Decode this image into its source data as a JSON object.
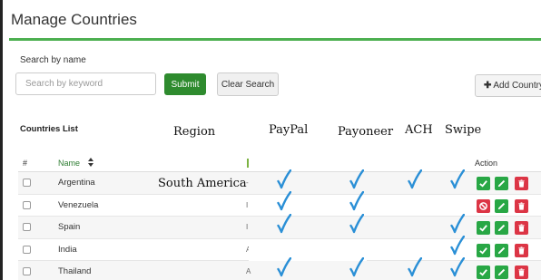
{
  "page": {
    "title": "Manage Countries"
  },
  "search": {
    "label": "Search by name",
    "placeholder": "Search by keyword",
    "submit_label": "Submit",
    "clear_label": "Clear Search"
  },
  "toolbar": {
    "add_label": "Add Country"
  },
  "list": {
    "title": "Countries List",
    "columns": {
      "index": "#",
      "name": "Name",
      "action": "Action"
    }
  },
  "annotations": {
    "region": "Region",
    "paypal": "PayPal",
    "payoneer": "Payoneer",
    "ach": "ACH",
    "swipe": "Swipe",
    "south_america": "South America"
  },
  "rows": [
    {
      "name": "Argentina",
      "region_visible": "-",
      "paypal": true,
      "payoneer": true,
      "ach": true,
      "swipe": true,
      "status_action": "approve"
    },
    {
      "name": "Venezuela",
      "region_visible": "I",
      "paypal": true,
      "payoneer": true,
      "ach": false,
      "swipe": false,
      "status_action": "block"
    },
    {
      "name": "Spain",
      "region_visible": "I",
      "paypal": true,
      "payoneer": true,
      "ach": false,
      "swipe": true,
      "status_action": "approve"
    },
    {
      "name": "India",
      "region_visible": "A",
      "paypal": false,
      "payoneer": false,
      "ach": false,
      "swipe": true,
      "status_action": "approve"
    },
    {
      "name": "Thailand",
      "region_visible": "A",
      "paypal": true,
      "payoneer": true,
      "ach": true,
      "swipe": true,
      "status_action": "approve"
    }
  ],
  "colors": {
    "accent_green": "#4caf50",
    "submit_green": "#2e8b2e",
    "action_green": "#28a745",
    "action_red": "#dc3545",
    "checkmark_blue": "#2a8fd6"
  },
  "icons": {
    "add": "plus-icon",
    "sort": "sort-icon",
    "approve": "check-icon",
    "block": "block-icon",
    "edit": "pencil-icon",
    "delete": "trash-icon",
    "tick": "checkmark-icon"
  }
}
